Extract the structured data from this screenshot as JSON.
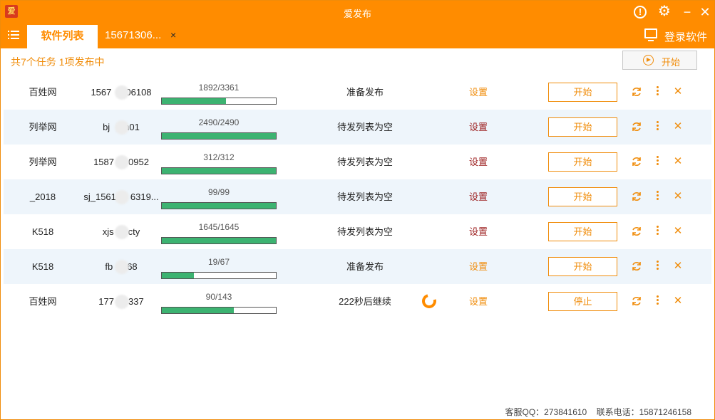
{
  "window": {
    "title": "爱发布",
    "logo_text": "爱"
  },
  "tabs": {
    "active": "软件列表",
    "second": "15671306...",
    "close": "×"
  },
  "header": {
    "login": "登录软件"
  },
  "toolbar": {
    "summary": "共7个任务 1项发布中",
    "start_all": "开始"
  },
  "tasks": [
    {
      "site": "百姓网",
      "account": "1567",
      "account_end": "06108",
      "progress_text": "1892/3361",
      "progress": 0.563,
      "status": "准备发布",
      "settings": "设置",
      "settings_color": "orange",
      "action": "开始",
      "alt": false
    },
    {
      "site": "列举网",
      "account": "bj",
      "account_end": "h01",
      "progress_text": "2490/2490",
      "progress": 1.0,
      "status": "待发列表为空",
      "settings": "设置",
      "settings_color": "dark",
      "action": "开始",
      "alt": true
    },
    {
      "site": "列举网",
      "account": "1587",
      "account_end": "0952",
      "progress_text": "312/312",
      "progress": 1.0,
      "status": "待发列表为空",
      "settings": "设置",
      "settings_color": "dark",
      "action": "开始",
      "alt": false
    },
    {
      "site": "_2018",
      "account": "sj_1561",
      "account_end": "6319...",
      "progress_text": "99/99",
      "progress": 1.0,
      "status": "待发列表为空",
      "settings": "设置",
      "settings_color": "dark",
      "action": "开始",
      "alt": true
    },
    {
      "site": "K518",
      "account": "xjs",
      "account_end": "cty",
      "progress_text": "1645/1645",
      "progress": 1.0,
      "status": "待发列表为空",
      "settings": "设置",
      "settings_color": "dark",
      "action": "开始",
      "alt": false
    },
    {
      "site": "K518",
      "account": "fb",
      "account_end": "68",
      "progress_text": "19/67",
      "progress": 0.284,
      "status": "准备发布",
      "settings": "设置",
      "settings_color": "orange",
      "action": "开始",
      "alt": true
    },
    {
      "site": "百姓网",
      "account": "177",
      "account_end": "337",
      "progress_text": "90/143",
      "progress": 0.629,
      "status": "222秒后继续",
      "settings": "设置",
      "settings_color": "orange",
      "action": "停止",
      "alt": false,
      "spinner": true
    }
  ],
  "footer": {
    "qq": "客服QQ：273841610",
    "phone": "联系电话：15871246158"
  },
  "colors": {
    "accent": "#ff8c00",
    "progress": "#3cb371",
    "row_alt": "#eef5fb"
  }
}
